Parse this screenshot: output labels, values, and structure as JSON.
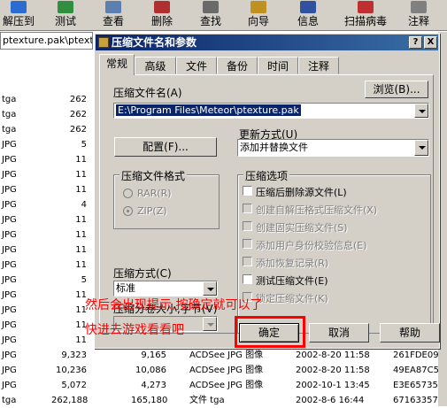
{
  "toolbar": {
    "items": [
      {
        "label": "解压到",
        "icon": "extract-icon",
        "color": "#2a6cd0"
      },
      {
        "label": "测试",
        "icon": "test-icon",
        "color": "#2f8f3f"
      },
      {
        "label": "查看",
        "icon": "view-icon",
        "color": "#5a7fb0"
      },
      {
        "label": "删除",
        "icon": "delete-icon",
        "color": "#b03030"
      },
      {
        "label": "查找",
        "icon": "find-icon",
        "color": "#6a6a6a"
      },
      {
        "label": "向导",
        "icon": "wizard-icon",
        "color": "#c09020"
      },
      {
        "label": "信息",
        "icon": "info-icon",
        "color": "#3050a0"
      },
      {
        "label": "扫描病毒",
        "icon": "scan-virus-icon",
        "color": "#c03030"
      },
      {
        "label": "注释",
        "icon": "comment-icon",
        "color": "#808080"
      }
    ]
  },
  "address": "ptexture.pak\\ptexture.pak",
  "files": [
    {
      "ext": "tga",
      "size": "262",
      "packed": "",
      "type": "",
      "modified": "",
      "crc": ""
    },
    {
      "ext": "tga",
      "size": "262",
      "packed": "",
      "type": "",
      "modified": "",
      "crc": ""
    },
    {
      "ext": "tga",
      "size": "262",
      "packed": "",
      "type": "",
      "modified": "",
      "crc": ""
    },
    {
      "ext": "JPG",
      "size": "5",
      "packed": "",
      "type": "",
      "modified": "",
      "crc": ""
    },
    {
      "ext": "JPG",
      "size": "11",
      "packed": "",
      "type": "",
      "modified": "",
      "crc": ""
    },
    {
      "ext": "JPG",
      "size": "11",
      "packed": "",
      "type": "",
      "modified": "",
      "crc": ""
    },
    {
      "ext": "JPG",
      "size": "11",
      "packed": "",
      "type": "",
      "modified": "",
      "crc": ""
    },
    {
      "ext": "JPG",
      "size": "4",
      "packed": "",
      "type": "",
      "modified": "",
      "crc": ""
    },
    {
      "ext": "JPG",
      "size": "11",
      "packed": "",
      "type": "",
      "modified": "",
      "crc": ""
    },
    {
      "ext": "JPG",
      "size": "11",
      "packed": "",
      "type": "",
      "modified": "",
      "crc": ""
    },
    {
      "ext": "JPG",
      "size": "11",
      "packed": "",
      "type": "",
      "modified": "",
      "crc": ""
    },
    {
      "ext": "JPG",
      "size": "11",
      "packed": "",
      "type": "",
      "modified": "",
      "crc": ""
    },
    {
      "ext": "JPG",
      "size": "5",
      "packed": "",
      "type": "",
      "modified": "",
      "crc": ""
    },
    {
      "ext": "JPG",
      "size": "11",
      "packed": "",
      "type": "",
      "modified": "",
      "crc": ""
    },
    {
      "ext": "JPG",
      "size": "11",
      "packed": "",
      "type": "",
      "modified": "",
      "crc": ""
    },
    {
      "ext": "JPG",
      "size": "11",
      "packed": "",
      "type": "",
      "modified": "",
      "crc": ""
    },
    {
      "ext": "JPG",
      "size": "11",
      "packed": "",
      "type": "",
      "modified": "",
      "crc": ""
    },
    {
      "ext": "JPG",
      "size": "9,323",
      "packed": "9,165",
      "type": "ACDSee JPG 图像",
      "modified": "2002-8-20 11:58",
      "crc": "261FDE09"
    },
    {
      "ext": "JPG",
      "size": "10,236",
      "packed": "10,086",
      "type": "ACDSee JPG 图像",
      "modified": "2002-8-20 11:58",
      "crc": "49EA87C5"
    },
    {
      "ext": "JPG",
      "size": "5,072",
      "packed": "4,273",
      "type": "ACDSee JPG 图像",
      "modified": "2002-10-1 13:45",
      "crc": "E3E65735"
    },
    {
      "ext": "tga",
      "size": "262,188",
      "packed": "165,180",
      "type": "文件 tga",
      "modified": "2002-8-6 16:44",
      "crc": "67163357"
    }
  ],
  "dialog": {
    "title": "压缩文件名和参数",
    "help_btn": "?",
    "close_btn": "X",
    "tabs": [
      "常规",
      "高级",
      "文件",
      "备份",
      "时间",
      "注释"
    ],
    "archive_name_label": "压缩文件名(A)",
    "browse_label": "浏览(B)...",
    "archive_name_value": "E:\\Program Files\\Meteor\\ptexture.pak",
    "update_mode_label": "更新方式(U)",
    "profiles_label": "配置(F)...",
    "update_mode_value": "添加并替换文件",
    "format_group": "压缩文件格式",
    "format_rar": "RAR(R)",
    "format_zip": "ZIP(Z)",
    "method_label": "压缩方式(C)",
    "method_value": "标准",
    "volume_label": "压缩分卷大小,字节(V)",
    "volume_value": "",
    "options_group": "压缩选项",
    "options": [
      {
        "label": "压缩后删除源文件(L)",
        "checked": false,
        "disabled": false
      },
      {
        "label": "创建自解压格式压缩文件(X)",
        "checked": false,
        "disabled": true
      },
      {
        "label": "创建固实压缩文件(S)",
        "checked": false,
        "disabled": true
      },
      {
        "label": "添加用户身份校验信息(E)",
        "checked": false,
        "disabled": true
      },
      {
        "label": "添加恢复记录(R)",
        "checked": false,
        "disabled": true
      },
      {
        "label": "测试压缩文件(E)",
        "checked": false,
        "disabled": false
      },
      {
        "label": "锁定压缩文件(K)",
        "checked": false,
        "disabled": true
      }
    ],
    "ok_label": "确定",
    "cancel_label": "取消",
    "help_label": "帮助"
  },
  "annotation": {
    "line1": "然后会出现提示,按确定就可以了",
    "line2": "快进去游戏看看吧",
    "color": "#ff0000"
  }
}
